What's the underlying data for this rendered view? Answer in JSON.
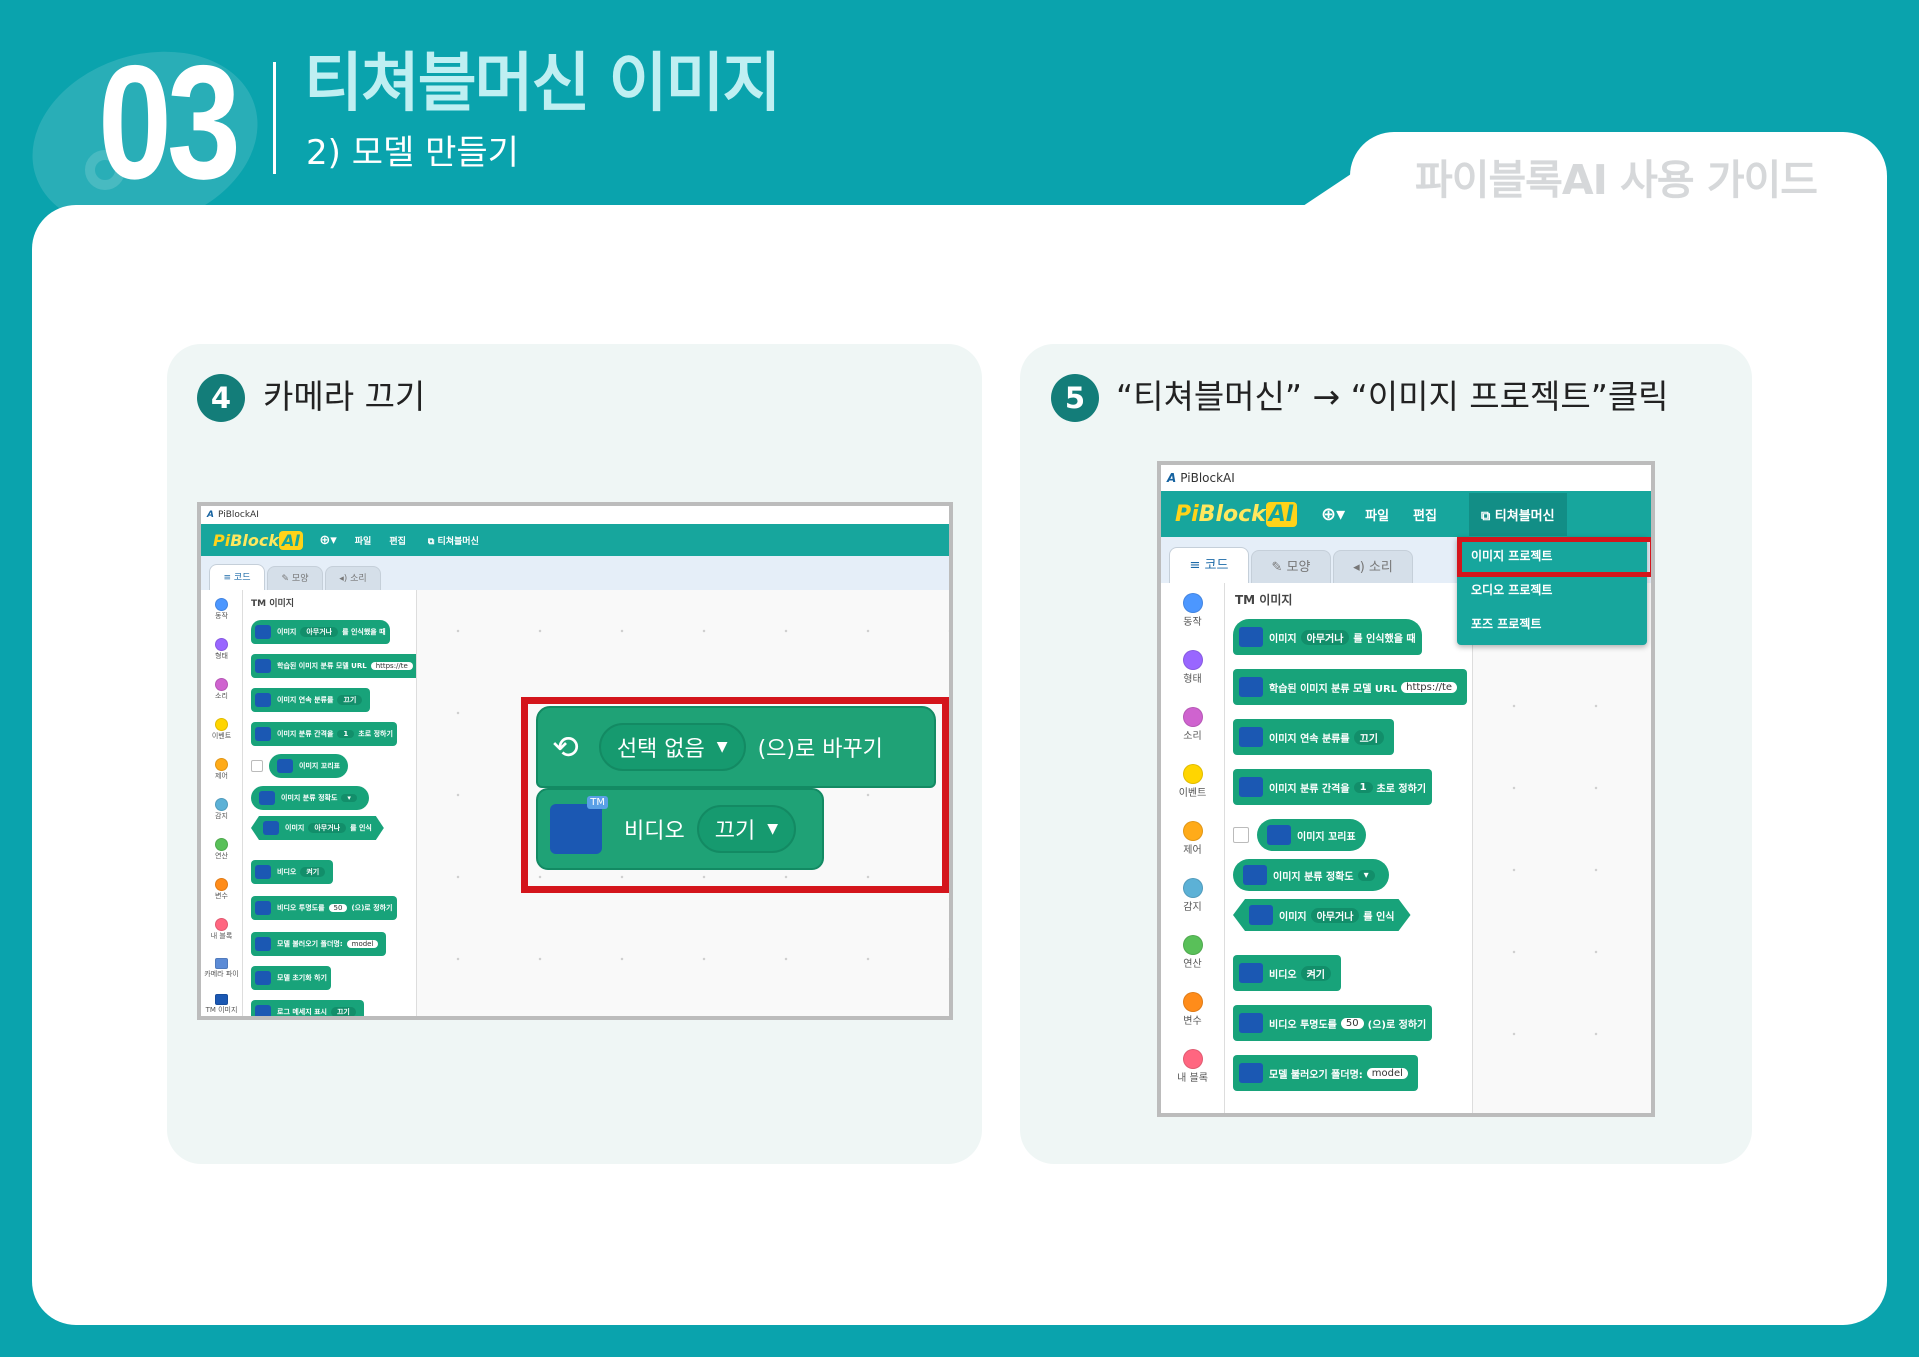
{
  "header": {
    "number": "03",
    "title": "티쳐블머신 이미지",
    "subtitle": "2) 모델 만들기",
    "guide": "파이블록AI 사용 가이드"
  },
  "step4": {
    "num": "4",
    "text": "카메라 끄기",
    "screenshot": {
      "app_title": "PiBlockAI",
      "menu": {
        "logo_pi": "Pi",
        "logo_block": "Block",
        "logo_ai": "AI",
        "file": "파일",
        "edit": "편집",
        "teachable": "티쳐블머신"
      },
      "tabs": [
        "코드",
        "모양",
        "소리"
      ],
      "categories": [
        "동작",
        "형태",
        "소리",
        "이벤트",
        "제어",
        "감지",
        "연산",
        "변수",
        "내 블록",
        "카메라 파이",
        "TM 이미지"
      ],
      "palette_title": "TM 이미지",
      "blocks": [
        "이미지",
        "아무거나",
        "를 인식했을 때",
        "학습된 이미지 분류 모델 URL",
        "https://te",
        "이미지 연속 분류를",
        "끄기",
        "이미지 분류 간격을",
        "1",
        "초로 정하기",
        "이미지 꼬리표",
        "이미지 분류 정확도",
        "를 인식",
        "비디오",
        "켜기",
        "비디오 투명도를",
        "50",
        "(으)로 정하기",
        "모델 불러오기 폴더명:",
        "model",
        "모델 초기화 하기",
        "로그 메세지 표시"
      ],
      "zoom": {
        "select": "선택 없음",
        "change": "(으)로 바꾸기",
        "video": "비디오",
        "off": "끄기"
      }
    }
  },
  "step5": {
    "num": "5",
    "text": "“티쳐블머신” → “이미지 프로젝트”클릭",
    "screenshot": {
      "app_title": "PiBlockAI",
      "menu": {
        "logo_pi": "Pi",
        "logo_block": "Block",
        "logo_ai": "AI",
        "file": "파일",
        "edit": "편집",
        "teachable": "티쳐블머신"
      },
      "tabs": [
        "코드",
        "모양",
        "소리"
      ],
      "categories": [
        "동작",
        "형태",
        "소리",
        "이벤트",
        "제어",
        "감지",
        "연산",
        "변수",
        "내 블록"
      ],
      "palette_title": "TM 이미지",
      "dropdown": [
        "이미지 프로젝트",
        "오디오 프로젝트",
        "포즈 프로젝트"
      ],
      "blocks": [
        "이미지",
        "아무거나",
        "를 인식했을 때",
        "학습된 이미지 분류 모델 URL",
        "https://te",
        "이미지 연속 분류를",
        "끄기",
        "이미지 분류 간격을",
        "1",
        "초로 정하기",
        "이미지 꼬리표",
        "이미지 분류 정확도",
        "를 인식",
        "비디오",
        "켜기",
        "비디오 투명도를",
        "50",
        "(으)로 정하기",
        "모델 불러오기 폴더명:",
        "model"
      ]
    }
  },
  "colors": {
    "teal": "#0aa3ad",
    "menu_teal": "#17a69d",
    "block_green": "#18a37a",
    "highlight_red": "#d4151c",
    "step_badge": "#137d79"
  },
  "icons": [
    "globe-icon",
    "teachable-icon",
    "tm-image-icon",
    "camera-switch-icon",
    "code-icon",
    "brush-icon",
    "speaker-icon"
  ]
}
